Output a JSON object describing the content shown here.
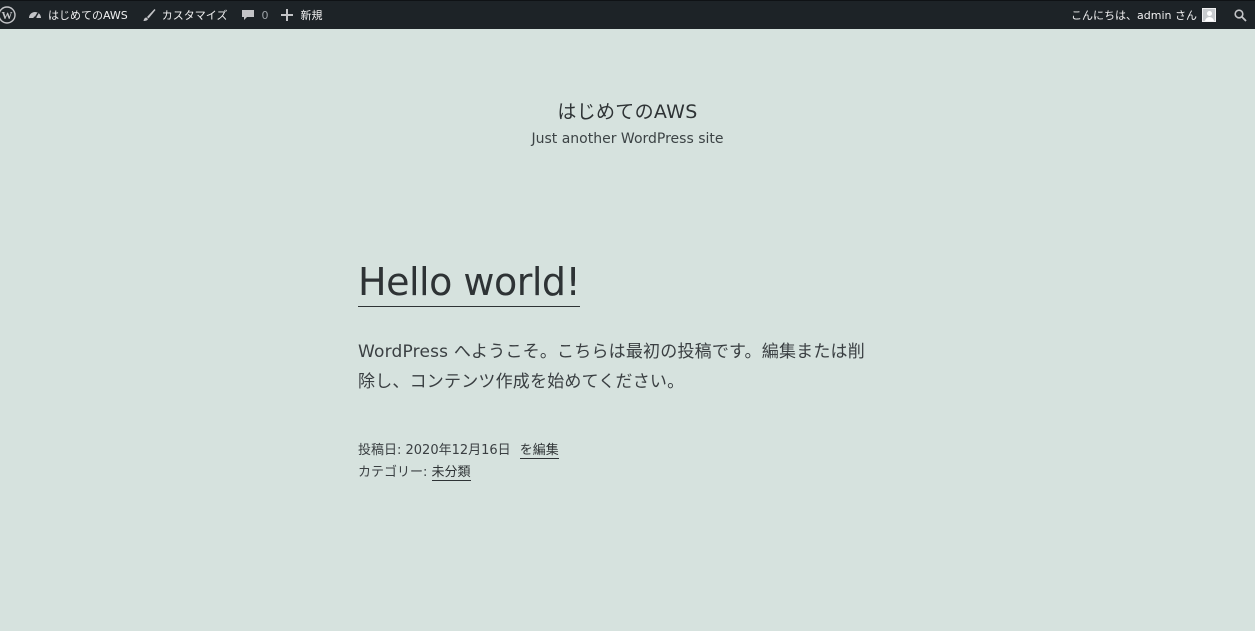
{
  "adminbar": {
    "site_name": "はじめてのAWS",
    "customize_label": "カスタマイズ",
    "comments_count": "0",
    "new_label": "新規",
    "greeting": "こんにちは、admin さん"
  },
  "site": {
    "title": "はじめてのAWS",
    "description": "Just another WordPress site"
  },
  "post": {
    "title": "Hello world!",
    "body_line1": "WordPress へようこそ。こちらは最初の投稿です。編集または削",
    "body_line2": "除し、コンテンツ作成を始めてください。",
    "date_prefix": "投稿日: 2020年12月16日",
    "edit_label": "を編集",
    "category_prefix": "カテゴリー: ",
    "category": "未分類"
  },
  "colors": {
    "adminbar_bg": "#1d2327",
    "page_bg": "#d6e2de",
    "text": "#2e3335"
  },
  "icons": {
    "wordpress": "wordpress-logo-icon",
    "dashboard": "dashboard-icon",
    "brush": "brush-icon",
    "comment": "comment-bubble-icon",
    "plus": "plus-icon",
    "search": "search-icon"
  }
}
